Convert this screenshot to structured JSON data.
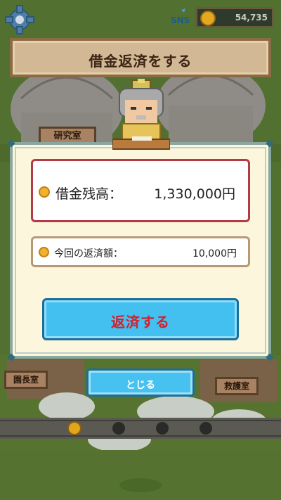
{
  "hud": {
    "coins": "54,735",
    "sns_label": "SNS"
  },
  "dialog": {
    "title": "借金返済をする",
    "debt_label": "借金残高：",
    "debt_value": "1,330,000円",
    "repay_amount_label": "今回の返済額：",
    "repay_amount_value": "10,000円",
    "repay_button": "返済する",
    "close_button": "とじる"
  },
  "map_signs": {
    "lab": "研究室",
    "director": "園長室",
    "rescue": "救護室"
  },
  "colors": {
    "accent_blue": "#44c0f0",
    "repay_text_red": "#d51f2d",
    "debt_border_red": "#b13b48",
    "coin_gold": "#f0b22a"
  }
}
